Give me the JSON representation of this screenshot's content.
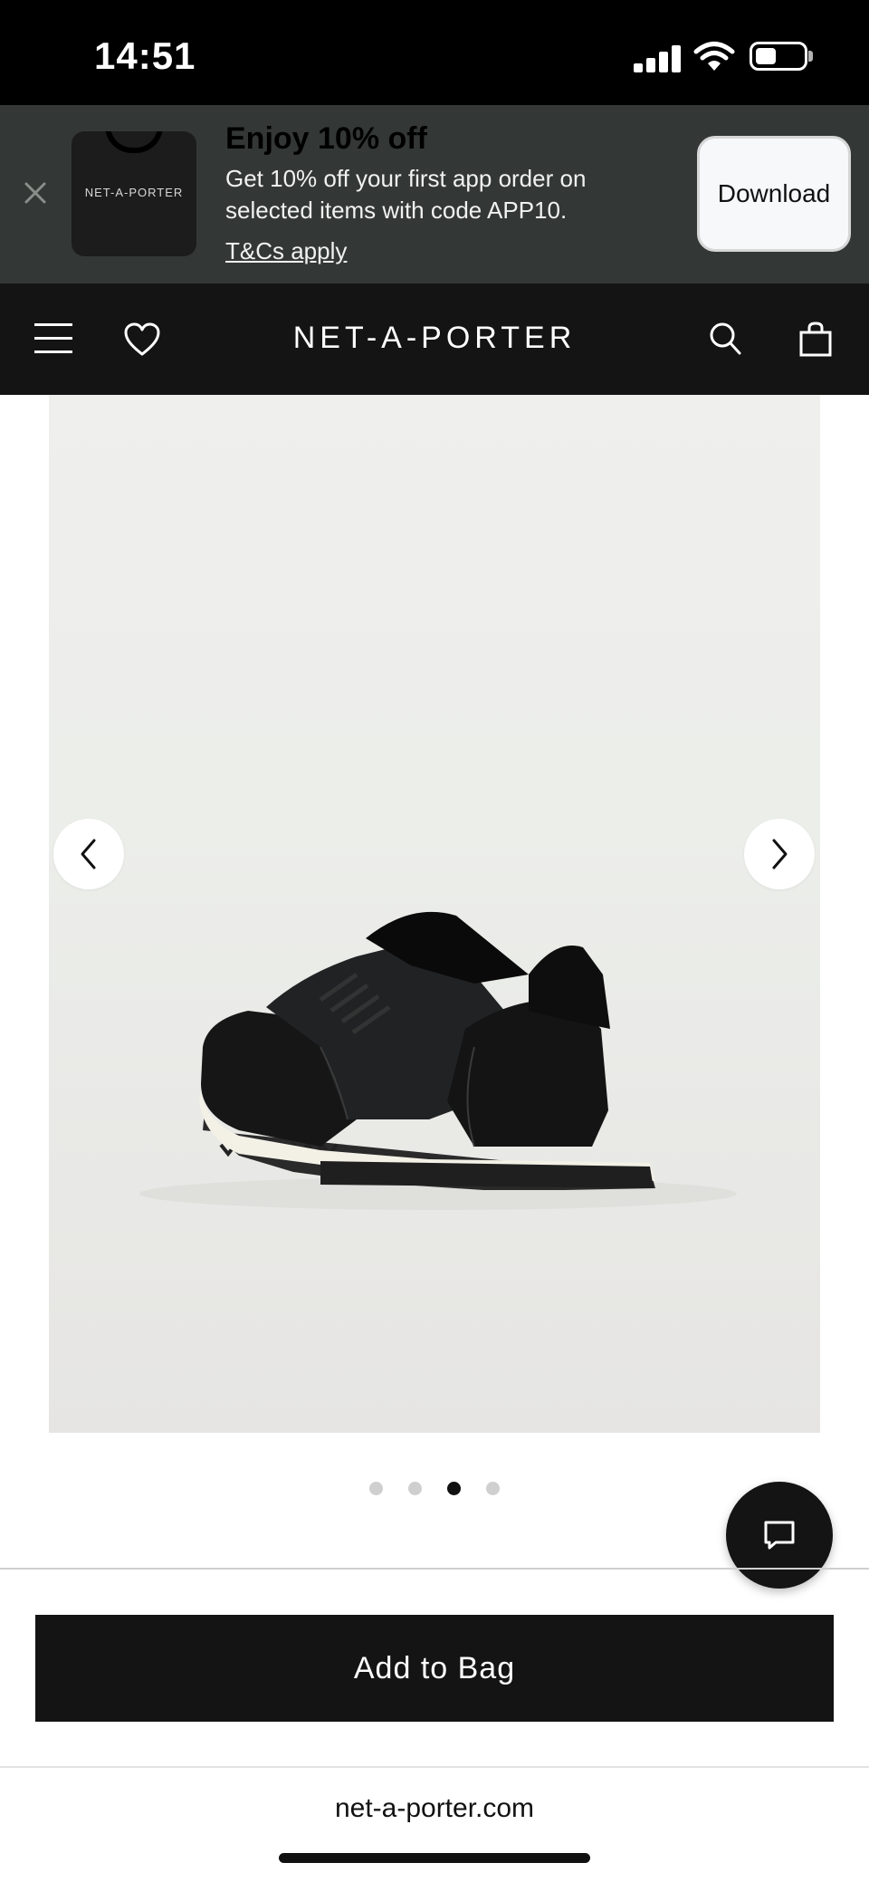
{
  "status_bar": {
    "time": "14:51"
  },
  "promo": {
    "logo_text": "NET-A-PORTER",
    "title": "Enjoy 10% off",
    "description": "Get 10% off your first app order on selected items with code APP10.",
    "link": "T&Cs apply",
    "download_label": "Download"
  },
  "header": {
    "brand": "NET-A-PORTER"
  },
  "gallery": {
    "image_count": 4,
    "active_index": 2
  },
  "actions": {
    "add_to_bag_label": "Add to Bag"
  },
  "browser": {
    "url": "net-a-porter.com"
  },
  "colors": {
    "header_bg": "#141414",
    "promo_bg": "#333836",
    "button_bg": "#141414"
  }
}
